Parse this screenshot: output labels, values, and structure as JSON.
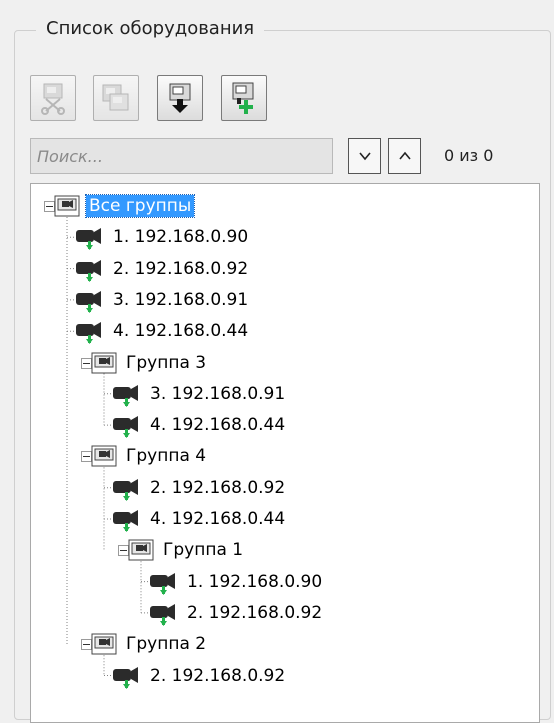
{
  "groupbox": {
    "title": "Список оборудования"
  },
  "toolbar": {
    "buttons": [
      {
        "name": "cut-button",
        "enabled": false
      },
      {
        "name": "copy-button",
        "enabled": false
      },
      {
        "name": "move-down-button",
        "enabled": true
      },
      {
        "name": "add-group-button",
        "enabled": true
      }
    ]
  },
  "search": {
    "placeholder": "Поиск...",
    "value": "",
    "counter": "0 из 0"
  },
  "tree": {
    "nodes": [
      {
        "type": "group",
        "label": "Все группы",
        "depth": 0,
        "selected": true
      },
      {
        "type": "camera",
        "label": "1. 192.168.0.90",
        "depth": 1
      },
      {
        "type": "camera",
        "label": "2. 192.168.0.92",
        "depth": 1
      },
      {
        "type": "camera",
        "label": "3. 192.168.0.91",
        "depth": 1
      },
      {
        "type": "camera",
        "label": "4. 192.168.0.44",
        "depth": 1
      },
      {
        "type": "group",
        "label": "Группа 3",
        "depth": 1
      },
      {
        "type": "camera",
        "label": "3. 192.168.0.91",
        "depth": 2
      },
      {
        "type": "camera",
        "label": "4. 192.168.0.44",
        "depth": 2
      },
      {
        "type": "group",
        "label": "Группа 4",
        "depth": 1
      },
      {
        "type": "camera",
        "label": "2. 192.168.0.92",
        "depth": 2
      },
      {
        "type": "camera",
        "label": "4. 192.168.0.44",
        "depth": 2
      },
      {
        "type": "group",
        "label": "Группа 1",
        "depth": 2
      },
      {
        "type": "camera",
        "label": "1. 192.168.0.90",
        "depth": 3
      },
      {
        "type": "camera",
        "label": "2. 192.168.0.92",
        "depth": 3
      },
      {
        "type": "group",
        "label": "Группа 2",
        "depth": 1
      },
      {
        "type": "camera",
        "label": "2. 192.168.0.92",
        "depth": 2
      }
    ]
  }
}
